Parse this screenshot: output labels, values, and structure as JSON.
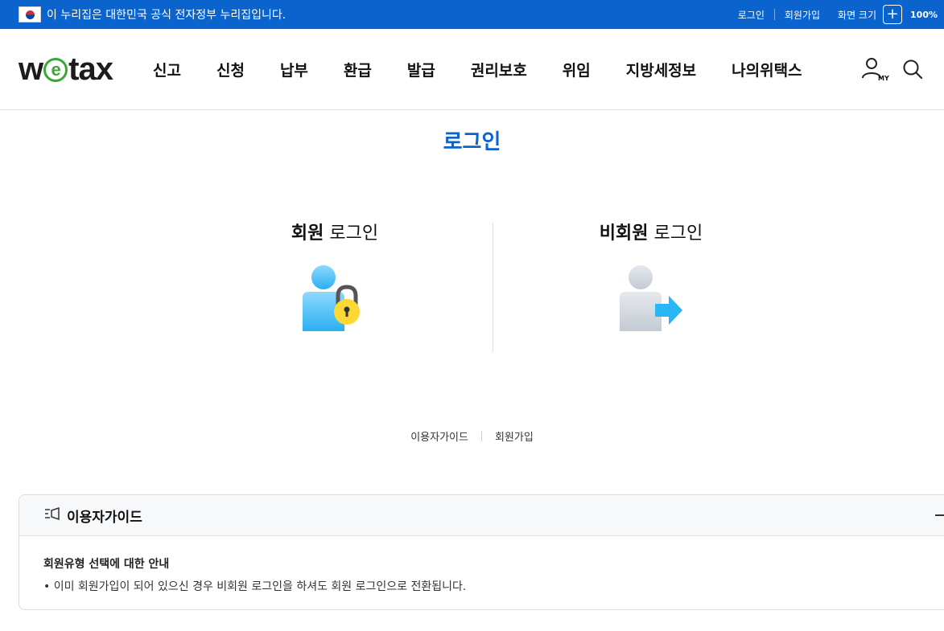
{
  "gov_bar": {
    "notice": "이 누리집은 대한민국 공식 전자정부 누리집입니다.",
    "login": "로그인",
    "signup": "회원가입",
    "screen_size": "화면 크기",
    "zoom_plus": "+",
    "zoom_level": "100%"
  },
  "header": {
    "logo_w": "w",
    "logo_e": "e",
    "logo_tax": "tax",
    "menu": [
      "신고",
      "신청",
      "납부",
      "환급",
      "발급",
      "권리보호",
      "위임",
      "지방세정보",
      "나의위택스"
    ],
    "my_label": "MY"
  },
  "main": {
    "title": "로그인",
    "member": {
      "bold": "회원",
      "rest": " 로그인"
    },
    "guest": {
      "bold": "비회원",
      "rest": " 로그인"
    },
    "links": {
      "guide": "이용자가이드",
      "signup": "회원가입"
    }
  },
  "guide": {
    "title": "이용자가이드",
    "question": "회원유형 선택에 대한 안내",
    "answer": "• 이미 회원가입이 되어 있으신 경우 비회원 로그인을 하셔도 회원 로그인으로 전환됩니다."
  },
  "colors": {
    "gov_bar": "#0b63ce",
    "title_blue": "#0b63ce",
    "logo_green": "#39a935",
    "lock_yellow": "#fdd835",
    "person_blue": "#4fc3f7"
  }
}
